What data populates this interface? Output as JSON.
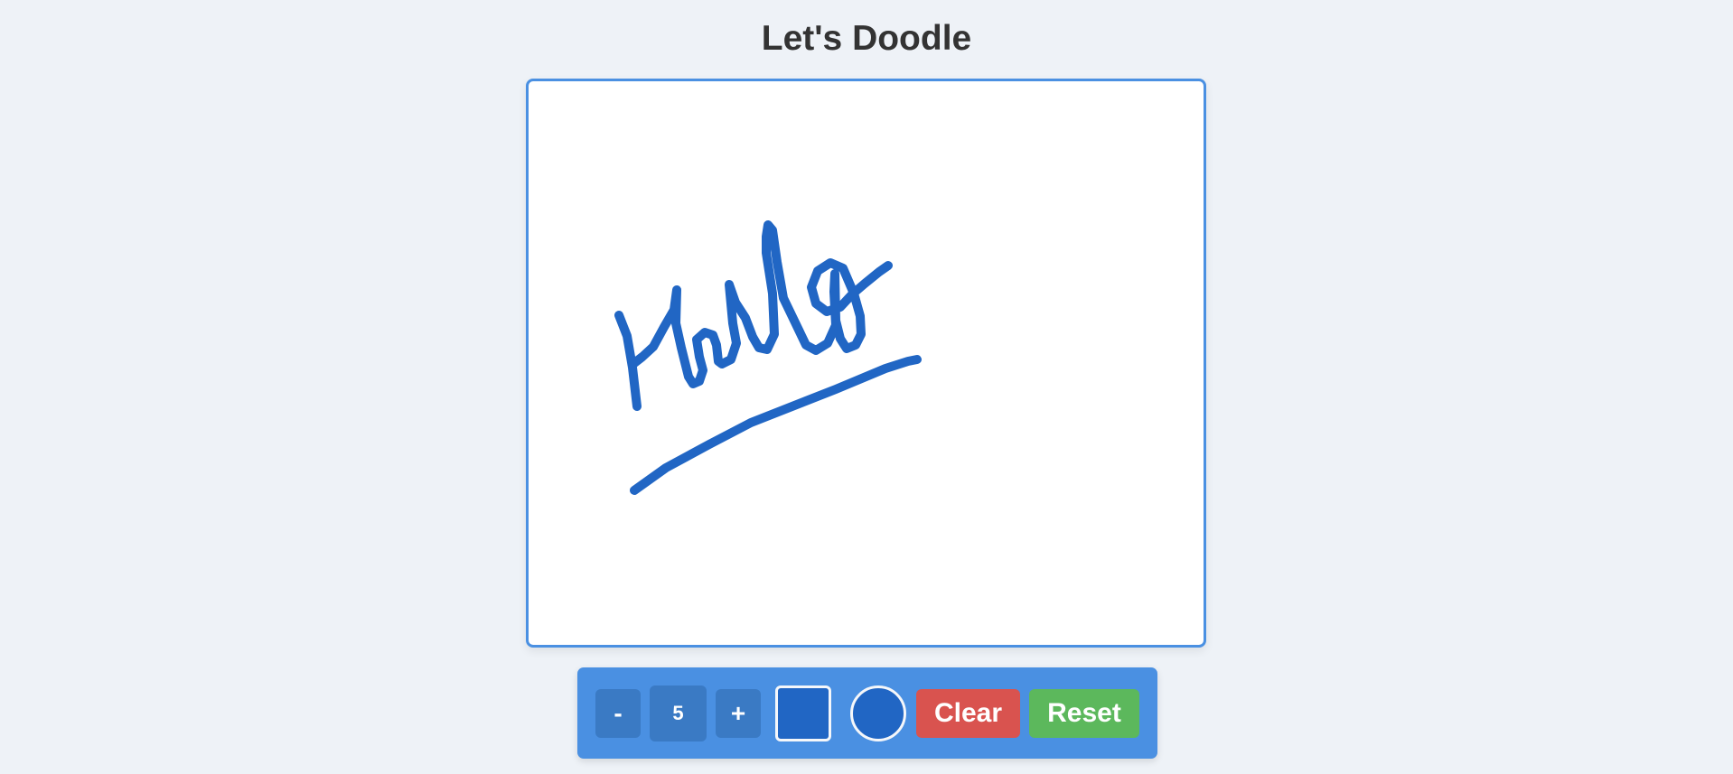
{
  "page": {
    "title": "Let's Doodle"
  },
  "toolbar": {
    "decrease_label": "-",
    "brush_size": "5",
    "increase_label": "+",
    "clear_label": "Clear",
    "reset_label": "Reset"
  },
  "colors": {
    "background": "#eef2f7",
    "accent": "#4a90e2",
    "toolbar_button": "#3a7ac4",
    "stroke": "#2166c4",
    "clear": "#d9534f",
    "reset": "#5cb85c"
  },
  "icons": {
    "swatch": "color-swatch-icon",
    "brush": "brush-preview-icon"
  }
}
